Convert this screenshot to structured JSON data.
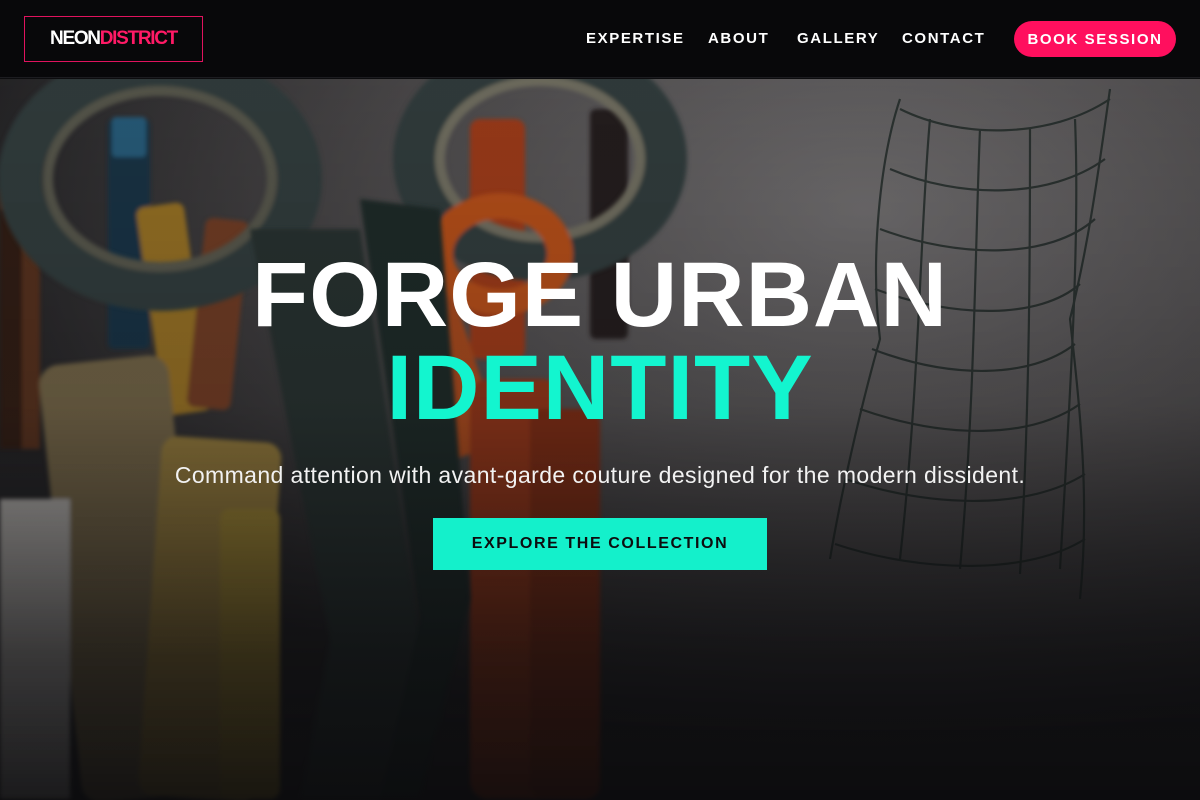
{
  "brand": {
    "word1": "NEON",
    "word2": "DISTRICT",
    "accent_color": "#ff1a66"
  },
  "nav": {
    "links": [
      {
        "label": "EXPERTISE"
      },
      {
        "label": "ABOUT"
      },
      {
        "label": "GALLERY"
      },
      {
        "label": "CONTACT"
      }
    ],
    "cta_label": "BOOK SESSION",
    "cta_color": "#ff0f5e"
  },
  "hero": {
    "headline_line1": "FORGE URBAN",
    "headline_line2": "IDENTITY",
    "headline_accent_color": "#13f5cf",
    "tagline": "Command attention with avant-garde couture designed for the modern dissident.",
    "cta_label": "EXPLORE THE COLLECTION",
    "cta_color": "#14f0cb",
    "background_image": "scissors-pencils-sketch-photo"
  }
}
